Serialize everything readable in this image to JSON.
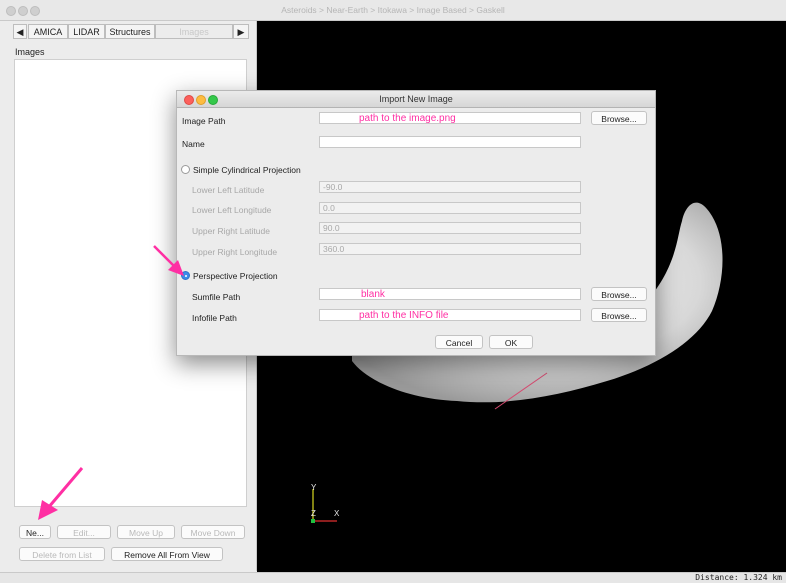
{
  "window": {
    "title": "Asteroids > Near-Earth > Itokawa > Image Based > Gaskell"
  },
  "left_panel": {
    "tabs": [
      "AMICA",
      "LIDAR",
      "Structures",
      "Images"
    ],
    "scroll_right": "▶",
    "scroll_left": "◀",
    "section_label": "Images",
    "buttons": {
      "new": "Ne...",
      "edit": "Edit...",
      "move_up": "Move Up",
      "move_down": "Move Down",
      "delete_from_list": "Delete from List",
      "remove_all": "Remove All From View"
    }
  },
  "viewer": {
    "axis_labels": {
      "y": "Y",
      "z": "Z",
      "x": "X"
    },
    "status": "Distance:   1.324 km"
  },
  "dialog": {
    "title": "Import New Image",
    "image_path_label": "Image Path",
    "image_path_value": "path to the image.png",
    "name_label": "Name",
    "name_value": "",
    "browse": "Browse...",
    "simple_cyl_label": "Simple Cylindrical Projection",
    "lower_left_lat_label": "Lower Left Latitude",
    "lower_left_lat_value": "-90.0",
    "lower_left_lon_label": "Lower Left Longitude",
    "lower_left_lon_value": "0.0",
    "upper_right_lat_label": "Upper Right Latitude",
    "upper_right_lat_value": "90.0",
    "upper_right_lon_label": "Upper Right Longitude",
    "upper_right_lon_value": "360.0",
    "perspective_label": "Perspective Projection",
    "perspective_selected": true,
    "sumfile_label": "Sumfile Path",
    "sumfile_value": "blank",
    "infofile_label": "Infofile Path",
    "infofile_value": "path to the INFO file",
    "cancel": "Cancel",
    "ok": "OK"
  },
  "colors": {
    "annotation": "#ff2fa3",
    "radio_selected": "#3b8be9",
    "viewer_bg": "#000000"
  }
}
